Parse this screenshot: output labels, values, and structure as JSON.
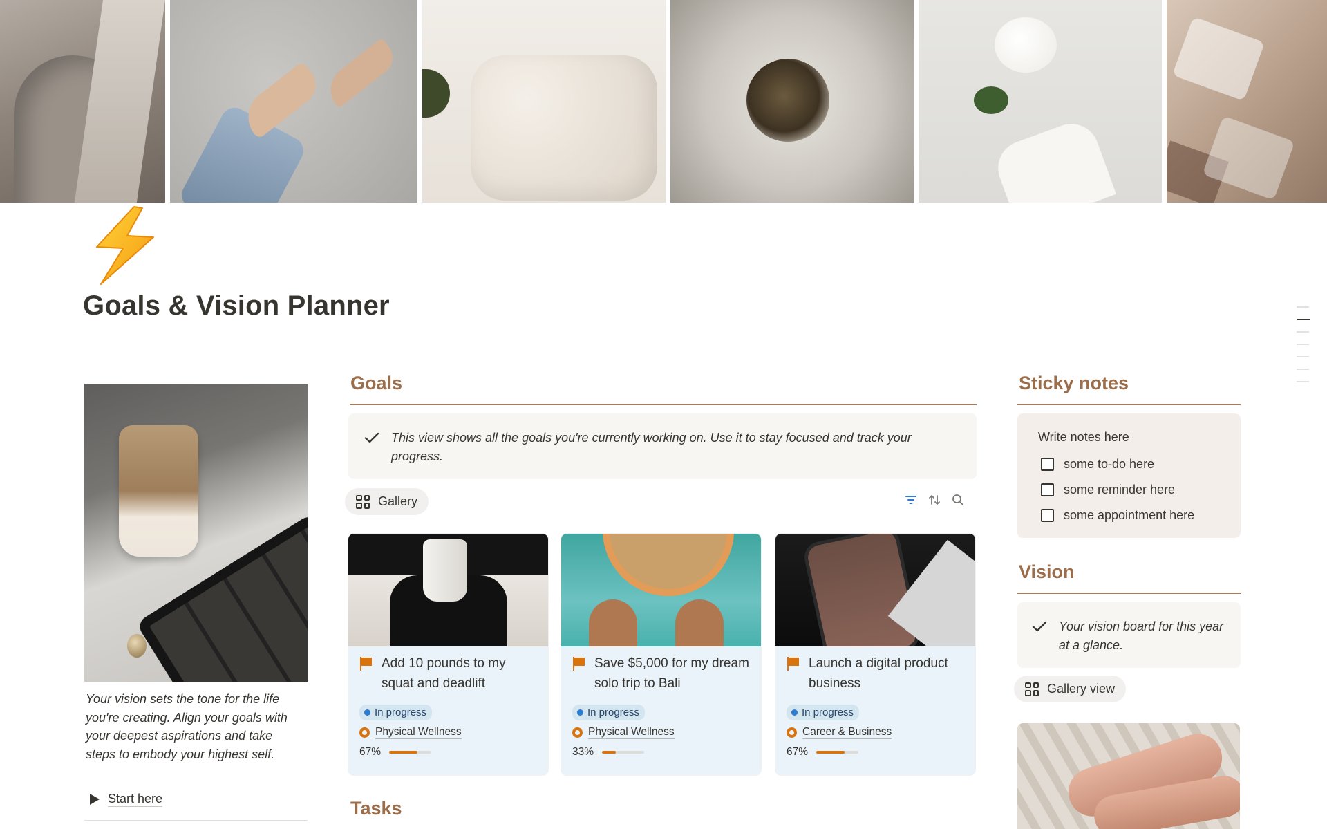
{
  "page": {
    "title": "Goals & Vision Planner",
    "icon": "lightning-bolt-icon"
  },
  "intro": {
    "text": "Your vision sets the tone for the life you're creating. Align your goals with your deepest aspirations and take steps to embody your highest self.",
    "toggle_label": "Start here"
  },
  "goals": {
    "heading": "Goals",
    "callout": "This view shows all the goals you're currently working on. Use it to stay focused and track your progress.",
    "view_label": "Gallery",
    "cards": [
      {
        "title": "Add 10 pounds to my squat and deadlift",
        "status": "In progress",
        "area": "Physical Wellness",
        "progress_label": "67%",
        "progress": 0.67
      },
      {
        "title": "Save $5,000 for my dream solo trip to Bali",
        "status": "In progress",
        "area": "Physical Wellness",
        "progress_label": "33%",
        "progress": 0.33
      },
      {
        "title": "Launch a digital product business",
        "status": "In progress",
        "area": "Career & Business",
        "progress_label": "67%",
        "progress": 0.67
      }
    ]
  },
  "tasks": {
    "heading": "Tasks"
  },
  "sticky": {
    "heading": "Sticky notes",
    "title": "Write notes here",
    "items": [
      "some to-do here",
      "some reminder here",
      "some appointment here"
    ]
  },
  "vision": {
    "heading": "Vision",
    "callout": "Your vision board for this year at a glance.",
    "view_label": "Gallery view"
  },
  "colors": {
    "accent_heading": "#9b6d4a",
    "progress_fill": "#d9730d",
    "status_bg": "#d3e5ef",
    "card_bg": "#eaf2fa"
  }
}
